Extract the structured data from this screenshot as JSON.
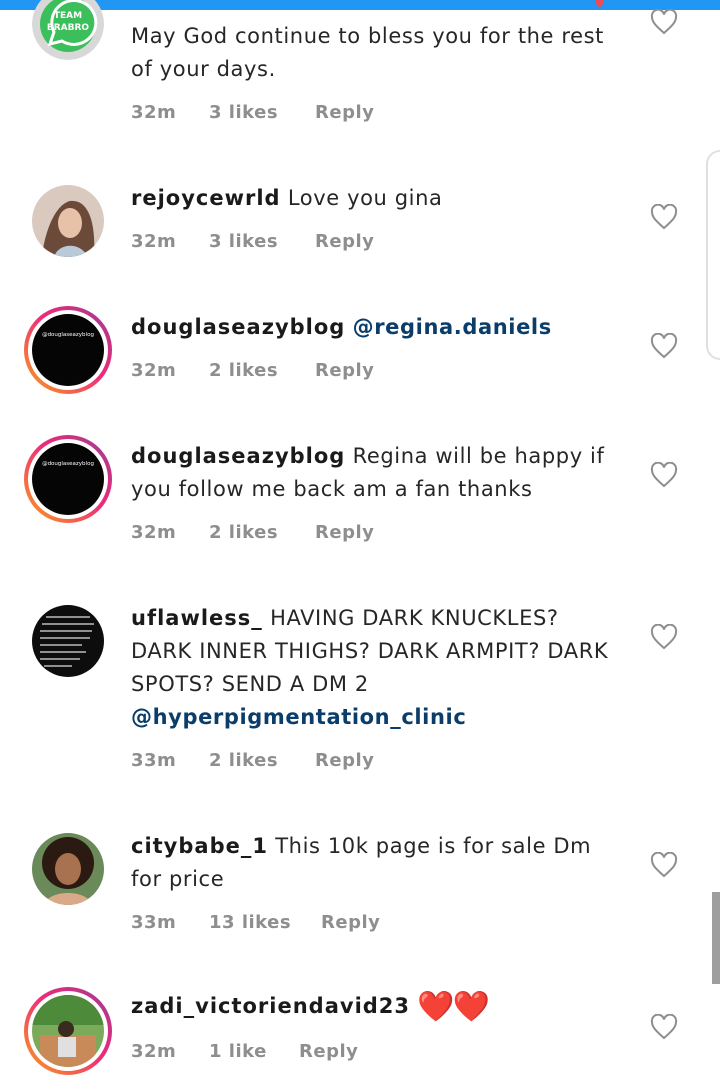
{
  "comments": [
    {
      "username": "",
      "text": "May God continue to bless you for the rest of your days.",
      "time": "32m",
      "likes": "3 likes",
      "reply": "Reply",
      "avatar": "team-brabro-whatsapp-logo",
      "avatar_text": "TEAM BRABRO"
    },
    {
      "username": "rejoycewrld",
      "text": "Love you gina",
      "time": "32m",
      "likes": "3 likes",
      "reply": "Reply",
      "avatar": "woman-portrait"
    },
    {
      "username": "douglaseazyblog",
      "text": "",
      "mention": "@regina.daniels",
      "time": "32m",
      "likes": "2 likes",
      "reply": "Reply",
      "avatar": "black-logo-story",
      "avatar_text": "@douglaseazyblog"
    },
    {
      "username": "douglaseazyblog",
      "text": "Regina will be happy if you follow me back am a fan thanks",
      "time": "32m",
      "likes": "2 likes",
      "reply": "Reply",
      "avatar": "black-logo-story",
      "avatar_text": "@douglaseazyblog"
    },
    {
      "username": "uflawless_",
      "text": "HAVING DARK KNUCKLES? DARK INNER THIGHS? DARK ARMPIT? DARK SPOTS? SEND A DM 2",
      "mention": "@hyperpigmentation_clinic",
      "time": "33m",
      "likes": "2 likes",
      "reply": "Reply",
      "avatar": "text-quote-dark"
    },
    {
      "username": "citybabe_1",
      "text": "This 10k page is for sale Dm for price",
      "time": "33m",
      "likes": "13 likes",
      "reply": "Reply",
      "avatar": "woman-curly-hair"
    },
    {
      "username": "zadi_victoriendavid23",
      "text": "",
      "emoji": "❤️❤️",
      "time": "32m",
      "likes": "1 like",
      "reply": "Reply",
      "avatar": "outdoor-photo-story"
    }
  ],
  "colors": {
    "accent_top": "#2196f3",
    "mention": "#0b3d6b",
    "meta": "#8e8e8e",
    "heart_red": "#d32027"
  },
  "icons": {
    "like": "heart-outline-icon"
  }
}
